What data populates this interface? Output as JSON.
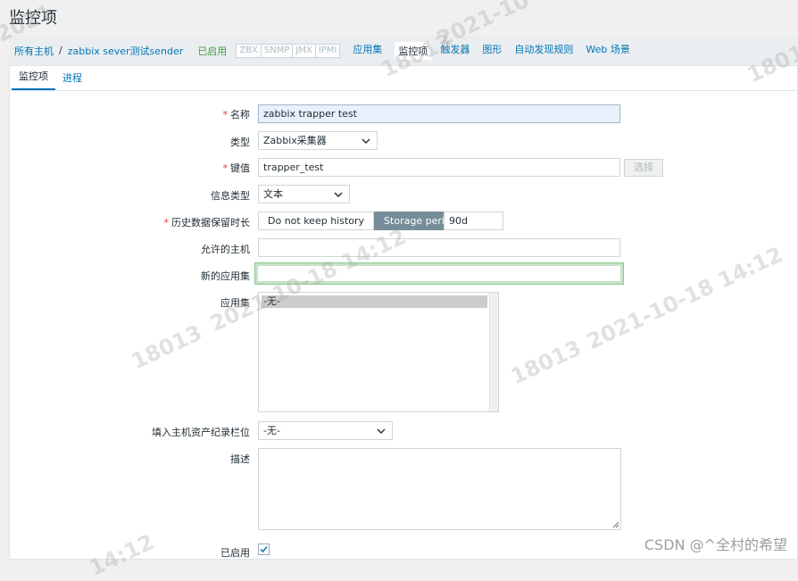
{
  "page": {
    "title": "监控项"
  },
  "breadcrumb": {
    "all_hosts": "所有主机",
    "separator": "/",
    "host": "zabbix sever测试sender",
    "status": "已启用"
  },
  "protocols": [
    "ZBX",
    "SNMP",
    "JMX",
    "IPMI"
  ],
  "host_nav": {
    "applications": "应用集",
    "items": "监控项",
    "triggers": "触发器",
    "graphs": "图形",
    "discovery": "自动发现规则",
    "web": "Web 场景"
  },
  "tabs": {
    "item": "监控项",
    "process": "进程"
  },
  "form": {
    "name_label": "名称",
    "name_value": "zabbix trapper test",
    "type_label": "类型",
    "type_value": "Zabbix采集器",
    "key_label": "键值",
    "key_value": "trapper_test",
    "key_select_button": "选择",
    "info_type_label": "信息类型",
    "info_type_value": "文本",
    "history_label": "历史数据保留时长",
    "history_option_dont_keep": "Do not keep history",
    "history_option_storage": "Storage period",
    "history_value": "90d",
    "allowed_hosts_label": "允许的主机",
    "allowed_hosts_value": "",
    "new_app_label": "新的应用集",
    "new_app_value": "",
    "applications_label": "应用集",
    "applications_options": [
      "-无-"
    ],
    "inventory_label": "填入主机资产纪录栏位",
    "inventory_value": "-无-",
    "description_label": "描述",
    "enabled_label": "已启用",
    "enabled": true
  },
  "watermark": {
    "text_a": "18013",
    "text_b": "2021-10-18 14:12",
    "text_c": "2021-10",
    "text_d": "14:12",
    "text_e": "2021"
  },
  "footer": {
    "credit": "CSDN @^全村的希望"
  }
}
